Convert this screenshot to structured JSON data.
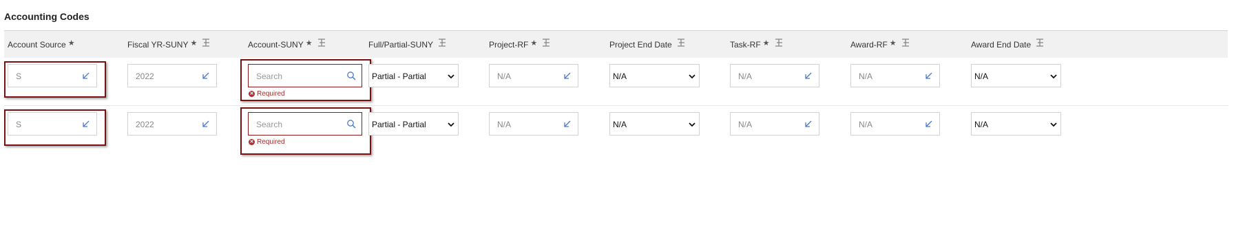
{
  "section_title": "Accounting Codes",
  "columns": [
    {
      "label": "Account Source",
      "required": "★",
      "filter": false
    },
    {
      "label": "Fiscal YR-SUNY",
      "required": "★",
      "filter": true
    },
    {
      "label": "Account-SUNY",
      "required": "★",
      "filter": true
    },
    {
      "label": "Full/Partial-SUNY",
      "required": "",
      "filter": true
    },
    {
      "label": "Project-RF",
      "required": "★",
      "filter": true
    },
    {
      "label": "Project End Date",
      "required": "",
      "filter": true
    },
    {
      "label": "Task-RF",
      "required": "★",
      "filter": true
    },
    {
      "label": "Award-RF",
      "required": "★",
      "filter": true
    },
    {
      "label": "Award End Date",
      "required": "",
      "filter": true
    }
  ],
  "rows": [
    {
      "account_source": "S",
      "fiscal_yr": "2022",
      "account_suny_placeholder": "Search",
      "account_suny_error": "Required",
      "full_partial": "Partial - Partial",
      "project_rf": "N/A",
      "project_end_date": "N/A",
      "task_rf": "N/A",
      "award_rf": "N/A",
      "award_end_date": "N/A"
    },
    {
      "account_source": "S",
      "fiscal_yr": "2022",
      "account_suny_placeholder": "Search",
      "account_suny_error": "Required",
      "full_partial": "Partial - Partial",
      "project_rf": "N/A",
      "project_end_date": "N/A",
      "task_rf": "N/A",
      "award_rf": "N/A",
      "award_end_date": "N/A"
    }
  ],
  "icons": {
    "lookup": "lookup-arrow-icon",
    "search": "search-icon",
    "dropdown": "chevron-down-icon",
    "column_filter": "column-filter-icon",
    "error": "error-circle-icon"
  },
  "colors": {
    "error_border": "#7a1010",
    "error_text": "#a52a2a",
    "icon_blue": "#4a7ac8",
    "header_bg": "#f1f1f1"
  }
}
